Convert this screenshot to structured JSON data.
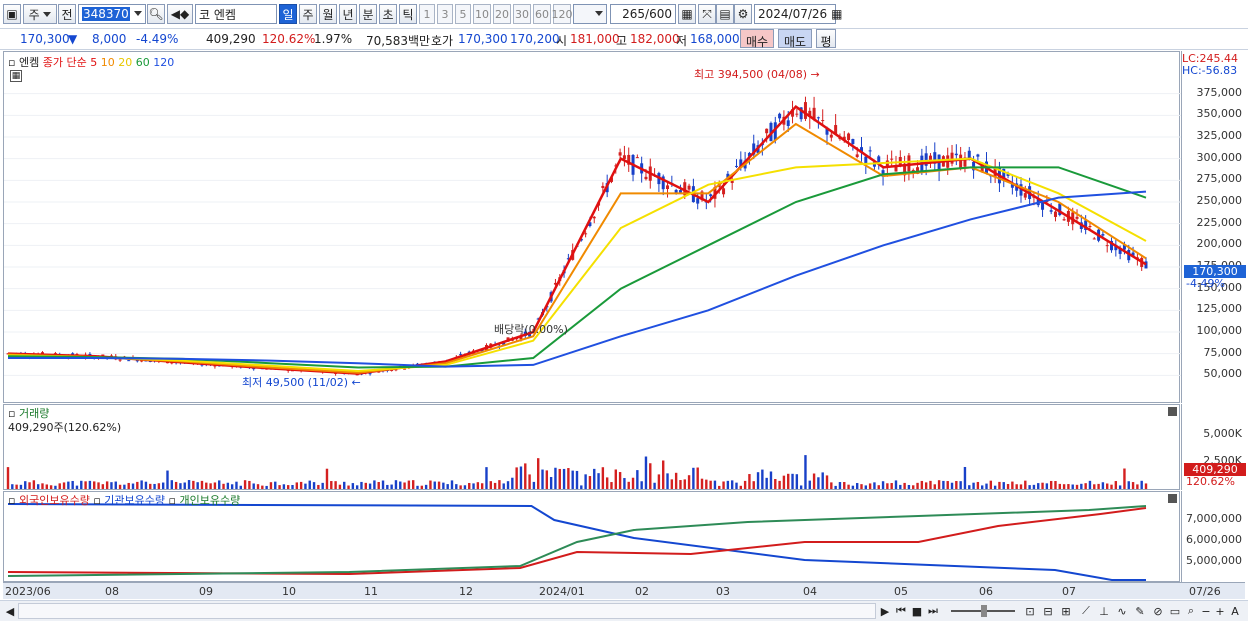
{
  "toolbar": {
    "market": "주",
    "prev_label": "전",
    "code": "348370",
    "exchange_label": "코",
    "stock_name": "엔켐",
    "periods": [
      "일",
      "주",
      "월",
      "년",
      "분",
      "초",
      "틱"
    ],
    "intervals": [
      "1",
      "3",
      "5",
      "10",
      "20",
      "30",
      "60",
      "120"
    ],
    "count": "265",
    "count_max": "/600",
    "date": "2024/07/26"
  },
  "quote": {
    "price": "170,300",
    "change": "8,000",
    "change_pct": "-4.49%",
    "volume": "409,290",
    "volume_ratio": "120.62%",
    "turnover_pct": "1.97%",
    "amount": "70,583백만",
    "ask_label": "호가",
    "ask": "170,300",
    "bid": "170,200",
    "open_label": "시",
    "open": "181,000",
    "high_label": "고",
    "high": "182,000",
    "low_label": "저",
    "low": "168,000",
    "buy_label": "매수",
    "sell_label": "매도",
    "eval_label": "평"
  },
  "price_panel": {
    "name": "엔켐",
    "ma_label": "종가 단순",
    "ma_periods": [
      "5",
      "10",
      "20",
      "60",
      "120"
    ],
    "lc": "LC:245.44",
    "hc": "HC:-56.83",
    "high_note": "최고 394,500 (04/08)",
    "low_note": "최저 49,500 (11/02)",
    "dividend_note": "배당락(0.00%)",
    "current_price": "170,300",
    "current_pct": "-4.49%",
    "y_ticks": [
      "375,000",
      "350,000",
      "325,000",
      "300,000",
      "275,000",
      "250,000",
      "225,000",
      "200,000",
      "175,000",
      "150,000",
      "125,000",
      "100,000",
      "75,000",
      "50,000"
    ]
  },
  "volume_panel": {
    "title": "거래량",
    "summary": "409,290주(120.62%)",
    "y_ticks": [
      "5,000K",
      "2,500K"
    ],
    "current": "409,290",
    "current_pct": "120.62%"
  },
  "holding_panel": {
    "legends": [
      "외국인보유수량",
      "기관보유수량",
      "개인보유수량"
    ],
    "y_ticks": [
      "7,000,000",
      "6,000,000",
      "5,000,000"
    ]
  },
  "dates": [
    "2023/06",
    "08",
    "09",
    "10",
    "11",
    "12",
    "2024/01",
    "02",
    "03",
    "04",
    "05",
    "06",
    "07",
    "07/26"
  ],
  "colors": {
    "ma5": "#e01010",
    "ma10": "#f08a00",
    "ma20": "#f5e000",
    "ma60": "#1a9a3a",
    "ma120": "#2050e0",
    "up": "#d42020",
    "down": "#1840c8"
  },
  "chart_data": {
    "type": "line",
    "title": "",
    "xlabel": "",
    "ylabel": "",
    "x": [
      "2023/06",
      "08",
      "09",
      "10",
      "11",
      "12",
      "2024/01",
      "02",
      "03",
      "04",
      "05",
      "06",
      "07",
      "07/26"
    ],
    "ylim": [
      40000,
      400000
    ],
    "series": [
      {
        "name": "5",
        "values": [
          75000,
          72000,
          65000,
          58000,
          52000,
          66000,
          100000,
          300000,
          250000,
          360000,
          290000,
          300000,
          240000,
          178000
        ]
      },
      {
        "name": "10",
        "values": [
          74000,
          71000,
          66000,
          59000,
          53000,
          64000,
          95000,
          260000,
          260000,
          340000,
          280000,
          290000,
          250000,
          185000
        ]
      },
      {
        "name": "20",
        "values": [
          73000,
          71000,
          67000,
          61000,
          55000,
          62000,
          90000,
          220000,
          270000,
          290000,
          295000,
          300000,
          260000,
          205000
        ]
      },
      {
        "name": "60",
        "values": [
          72000,
          71000,
          69000,
          64000,
          59000,
          60000,
          70000,
          150000,
          200000,
          250000,
          282000,
          290000,
          290000,
          255000
        ]
      },
      {
        "name": "120",
        "values": [
          70000,
          70000,
          69000,
          67000,
          64000,
          60000,
          62000,
          95000,
          125000,
          165000,
          200000,
          230000,
          255000,
          262000
        ]
      }
    ]
  }
}
